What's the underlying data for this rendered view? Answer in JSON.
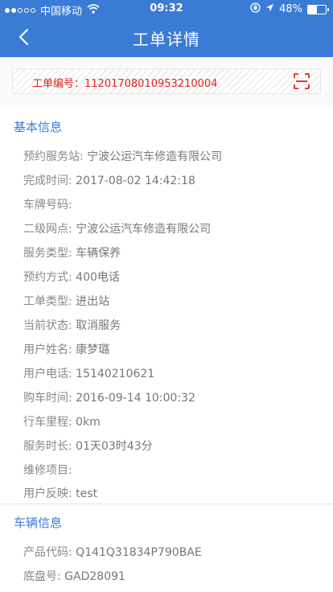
{
  "status_bar": {
    "carrier": "中国移动",
    "time": "09:32",
    "battery": "48%",
    "battery_level": 0.48
  },
  "nav": {
    "title": "工单详情"
  },
  "order": {
    "label": "工单编号：",
    "number": "11201708010953210004"
  },
  "basic_info": {
    "title": "基本信息",
    "rows": [
      {
        "label": "预约服务站:",
        "value": "宁波公运汽车修造有限公司"
      },
      {
        "label": "完成时间:",
        "value": "2017-08-02 14:42:18"
      },
      {
        "label": "车牌号码:",
        "value": ""
      },
      {
        "label": "二级网点:",
        "value": "宁波公运汽车修造有限公司"
      },
      {
        "label": "服务类型:",
        "value": "车辆保养"
      },
      {
        "label": "预约方式:",
        "value": "400电话"
      },
      {
        "label": "工单类型:",
        "value": "进出站"
      },
      {
        "label": "当前状态:",
        "value": "取消服务"
      },
      {
        "label": "用户姓名:",
        "value": "康梦璐"
      },
      {
        "label": "用户电话:",
        "value": "15140210621"
      },
      {
        "label": "购车时间:",
        "value": "2016-09-14 10:00:32"
      },
      {
        "label": "行车里程:",
        "value": "0km"
      },
      {
        "label": "服务时长:",
        "value": "01天03时43分"
      },
      {
        "label": "维修项目:",
        "value": ""
      },
      {
        "label": "用户反映:",
        "value": "test"
      }
    ]
  },
  "vehicle_info": {
    "title": "车辆信息",
    "rows": [
      {
        "label": "产品代码:",
        "value": "Q141Q31834P790BAE"
      },
      {
        "label": "底盘号:",
        "value": "GAD28091"
      }
    ]
  },
  "colors": {
    "header": "#3a7bd5",
    "order_number": "#e2231a",
    "section_title": "#3a7bd5"
  }
}
